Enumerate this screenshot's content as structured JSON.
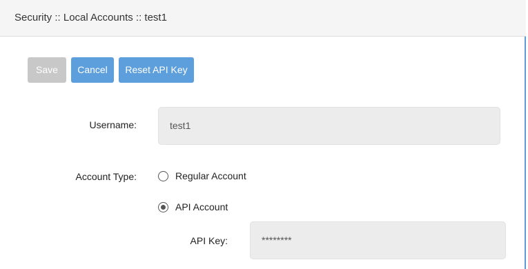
{
  "header": {
    "breadcrumb": "Security :: Local Accounts :: test1"
  },
  "toolbar": {
    "save_label": "Save",
    "cancel_label": "Cancel",
    "reset_api_key_label": "Reset API Key",
    "save_enabled": false
  },
  "form": {
    "username": {
      "label": "Username:",
      "value": "test1"
    },
    "account_type": {
      "label": "Account Type:",
      "options": [
        {
          "label": "Regular Account",
          "selected": false
        },
        {
          "label": "API Account",
          "selected": true
        }
      ]
    },
    "api_key": {
      "label": "API Key:",
      "value": "********"
    }
  },
  "colors": {
    "accent": "#5d9fdc",
    "disabled": "#c8c8c8",
    "border_accent": "#5b9bd5"
  }
}
